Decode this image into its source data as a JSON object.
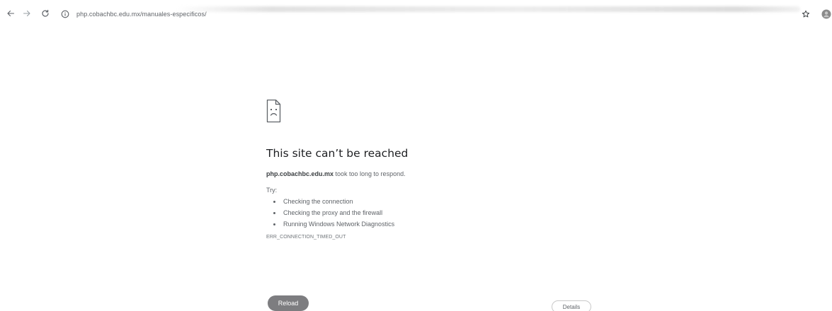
{
  "toolbar": {
    "back_icon": "arrow-left-icon",
    "forward_icon": "arrow-right-icon",
    "reload_icon": "reload-icon",
    "site_info_icon": "info-icon",
    "url": "php.cobachbc.edu.mx/manuales-especificos/",
    "bookmark_icon": "star-icon",
    "profile_icon": "avatar"
  },
  "error": {
    "icon": "sad-page-icon",
    "title": "This site can’t be reached",
    "host": "php.cobachbc.edu.mx",
    "message_rest": " took too long to respond.",
    "try_label": "Try:",
    "suggestions": [
      "Checking the connection",
      "Checking the proxy and the firewall",
      "Running Windows Network Diagnostics"
    ],
    "code": "ERR_CONNECTION_TIMED_OUT"
  },
  "buttons": {
    "reload": "Reload",
    "details": "Details"
  },
  "colors": {
    "reload_button_bg": "#7d7d80",
    "text_primary": "#202124",
    "text_secondary": "#5f6368"
  }
}
